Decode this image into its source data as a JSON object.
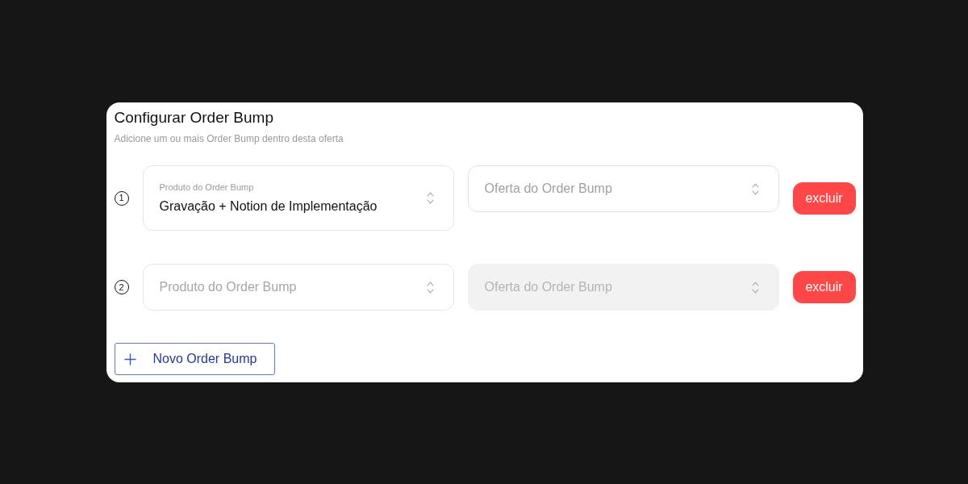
{
  "dialog": {
    "title": "Configurar Order Bump",
    "subtitle": "Adicione um ou mais Order Bump dentro desta oferta"
  },
  "order_bumps": [
    {
      "number": "1",
      "product": {
        "label": "Produto do Order Bump",
        "value": "Gravação + Notion de Implementação"
      },
      "offer": {
        "placeholder": "Oferta do Order Bump",
        "disabled": false
      },
      "delete_button": "excluir"
    },
    {
      "number": "2",
      "product": {
        "placeholder": "Produto do Order Bump"
      },
      "offer": {
        "placeholder": "Oferta do Order Bump",
        "disabled": true
      },
      "delete_button": "excluir"
    }
  ],
  "add_button": {
    "label": "Novo Order Bump"
  }
}
